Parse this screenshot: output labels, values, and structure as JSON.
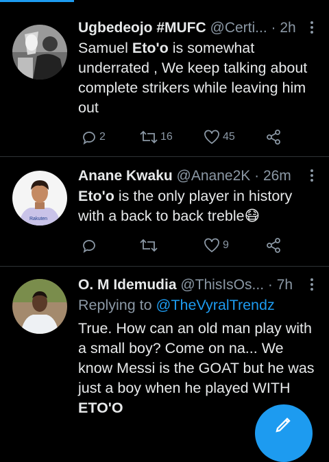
{
  "tweets": [
    {
      "name": "Ugbedeojo #MUFC",
      "handle": "@Certi...",
      "time": "· 2h",
      "text_before": "Samuel ",
      "text_bold": "Eto'o",
      "text_after": " is somewhat underrated , We keep talking about complete strikers while leaving him out",
      "replies": "2",
      "retweets": "16",
      "likes": "45"
    },
    {
      "name": "Anane Kwaku",
      "handle": "@Anane2K",
      "time": "· 26m",
      "text_bold": "Eto'o",
      "text_after": " is the only player in history with a back to back treble",
      "emoji": "😷",
      "likes": "9"
    },
    {
      "name": "O. M Idemudia",
      "handle": "@ThisIsOs...",
      "time": "· 7h",
      "reply_prefix": "Replying to ",
      "reply_handle": "@TheVyralTrendz",
      "text_before": "True. How can an old man play with a small boy? Come on na... We know Messi is the GOAT but he was just a boy when he played WITH ",
      "text_bold": "ETO'O"
    }
  ],
  "colors": {
    "accent": "#1d9bf0",
    "muted": "#8b98a5",
    "divider": "#2f3336"
  },
  "icons": [
    "reply-icon",
    "retweet-icon",
    "like-icon",
    "share-icon",
    "compose-icon",
    "more-icon"
  ]
}
